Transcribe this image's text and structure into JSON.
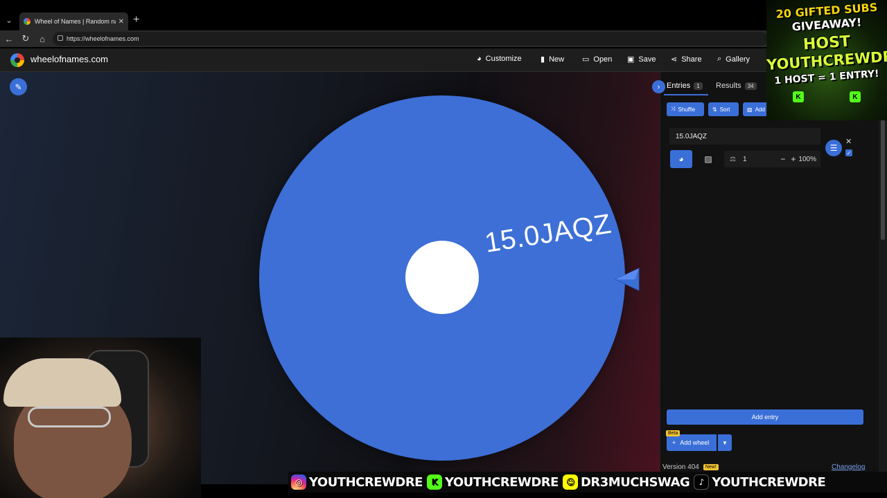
{
  "browser": {
    "tab_title": "Wheel of Names | Random name picker",
    "url": "https://wheelofnames.com"
  },
  "header": {
    "site_name": "wheelofnames.com",
    "customize": "Customize",
    "new": "New",
    "open": "Open",
    "save": "Save",
    "share": "Share",
    "gallery": "Gallery"
  },
  "wheel": {
    "segment_label": "15.0JAQZ",
    "color": "#3d6fd6"
  },
  "panel": {
    "tab_entries": "Entries",
    "entries_count": "1",
    "tab_results": "Results",
    "results_count": "34",
    "shuffle": "Shuffle",
    "sort": "Sort",
    "add_image": "Add",
    "entry_value": "15.0JAQZ",
    "weight_value": "1",
    "weight_percent": "100%",
    "add_entry": "Add entry",
    "beta": "Beta",
    "add_wheel": "Add wheel",
    "version": "Version 404",
    "new_badge": "New!",
    "changelog": "Changelog"
  },
  "overlay": {
    "giveaway_line1": "20 GIFTED SUBS",
    "giveaway_line2": "GIVEAWAY!",
    "giveaway_line3": "HOST",
    "giveaway_line4": "YOUTHCREWDRE",
    "giveaway_line5": "1 HOST = 1 ENTRY!",
    "socials": [
      {
        "handle": "YOUTHCREWDRE"
      },
      {
        "handle": "YOUTHCREWDRE"
      },
      {
        "handle": "DR3MUCHSWAG"
      },
      {
        "handle": "YOUTHCREWDRE"
      }
    ]
  },
  "colors": {
    "accent": "#3b6fd8",
    "badge": "#f4c430",
    "kick": "#53fc18"
  }
}
